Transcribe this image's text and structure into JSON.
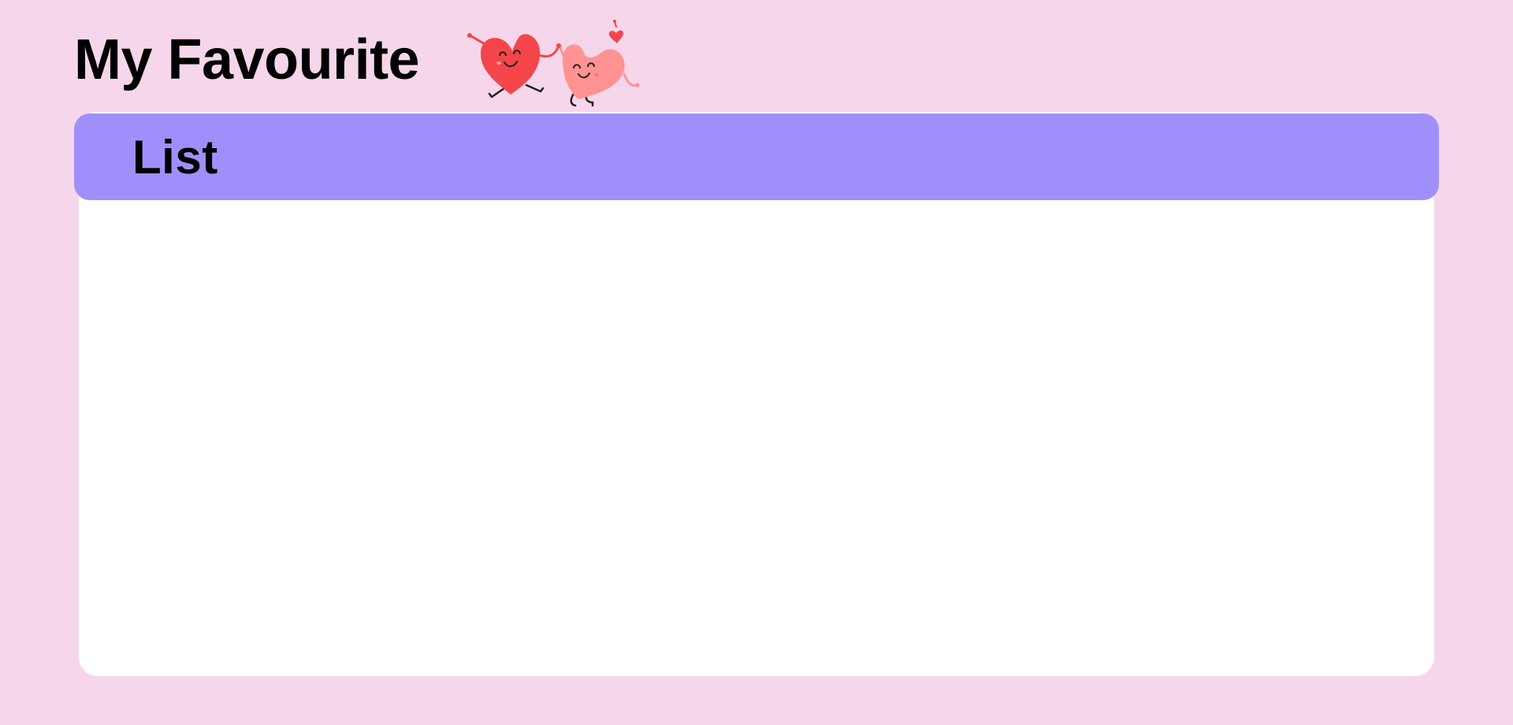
{
  "header": {
    "title": "My Favourite",
    "decoration_icon": "hearts-couple-icon"
  },
  "list_card": {
    "title": "List",
    "items": []
  },
  "colors": {
    "page_background": "#f6d6ea",
    "card_header": "#a08ffb",
    "card_background": "#ffffff",
    "heart_primary": "#f4454a",
    "heart_secondary": "#ff9393"
  }
}
